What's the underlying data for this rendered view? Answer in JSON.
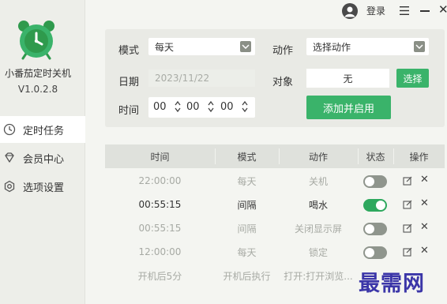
{
  "app": {
    "name": "小番茄定时关机",
    "version": "V1.0.2.8"
  },
  "titlebar": {
    "login_label": "登录"
  },
  "sidebar": {
    "items": [
      {
        "label": "定时任务",
        "icon": "clock-icon",
        "active": true
      },
      {
        "label": "会员中心",
        "icon": "diamond-icon",
        "active": false
      },
      {
        "label": "选项设置",
        "icon": "gear-icon",
        "active": false
      }
    ]
  },
  "form": {
    "mode_label": "模式",
    "mode_value": "每天",
    "action_label": "动作",
    "action_value": "选择动作",
    "date_label": "日期",
    "date_value": "2023/11/22",
    "target_label": "对象",
    "target_value": "无",
    "select_button": "选择",
    "time_label": "时间",
    "hour": "00",
    "minute": "00",
    "second": "00",
    "add_button": "添加并启用"
  },
  "table": {
    "headers": [
      "时间",
      "模式",
      "动作",
      "状态",
      "操作"
    ],
    "rows": [
      {
        "time": "22:00:00",
        "mode": "每天",
        "action": "关机",
        "enabled": false
      },
      {
        "time": "00:55:15",
        "mode": "间隔",
        "action": "喝水",
        "enabled": true
      },
      {
        "time": "00:55:15",
        "mode": "间隔",
        "action": "关闭显示屏",
        "enabled": false
      },
      {
        "time": "12:00:00",
        "mode": "每天",
        "action": "锁定",
        "enabled": false
      },
      {
        "time": "开机后5分",
        "mode": "开机后执行",
        "action": "打开:打开浏览...",
        "enabled": false
      }
    ]
  },
  "watermark": "最需网",
  "colors": {
    "accent": "#3ab36a",
    "toggle_on": "#2ea85e",
    "toggle_off": "#8f958d",
    "sidebar_bg": "#edeee9",
    "panel_bg": "#e9eae5"
  }
}
